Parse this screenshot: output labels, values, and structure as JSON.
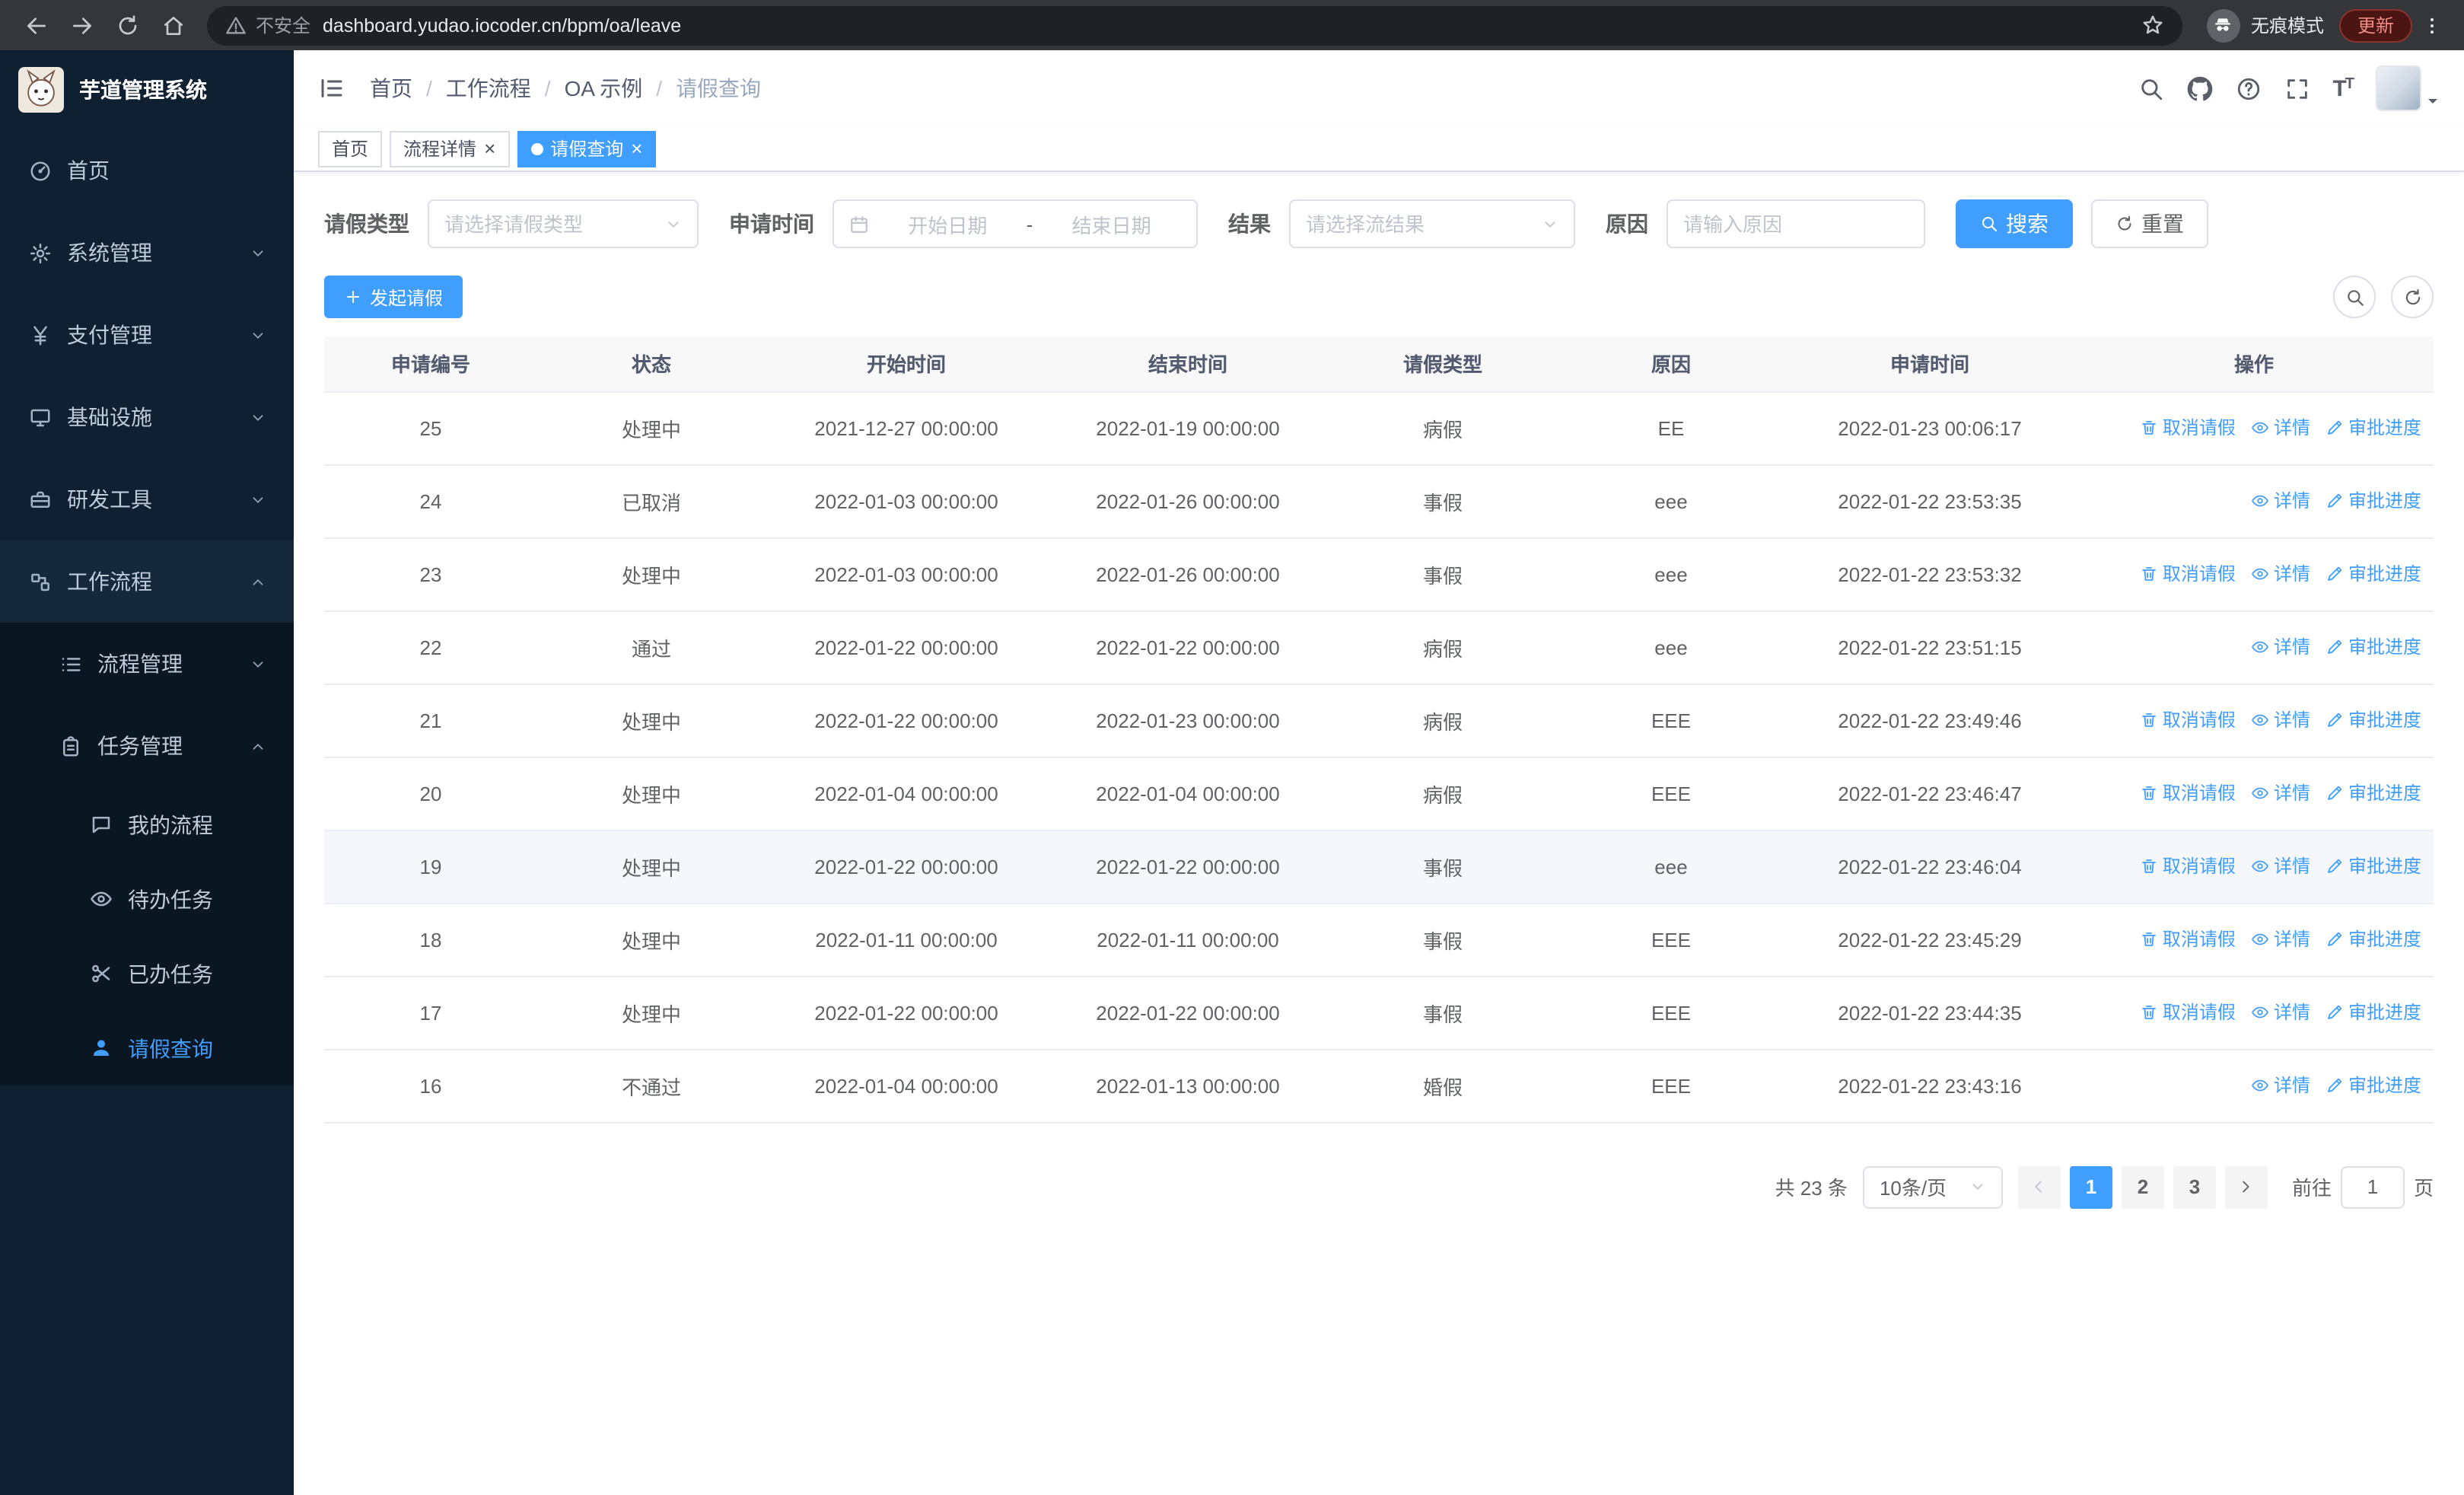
{
  "theme": {
    "primary": "#409eff",
    "sidebar_bg": "#0f2030",
    "sidebar_submenu_bg": "#0a1622",
    "tag_active_bg": "#409eff"
  },
  "browser": {
    "security_label": "不安全",
    "url": "dashboard.yudao.iocoder.cn/bpm/oa/leave",
    "incognito_label": "无痕模式",
    "update_label": "更新"
  },
  "sidebar": {
    "title": "芋道管理系统",
    "items": [
      {
        "label": "首页"
      },
      {
        "label": "系统管理"
      },
      {
        "label": "支付管理"
      },
      {
        "label": "基础设施"
      },
      {
        "label": "研发工具"
      },
      {
        "label": "工作流程"
      },
      {
        "label": "流程管理"
      },
      {
        "label": "任务管理"
      },
      {
        "label": "我的流程"
      },
      {
        "label": "待办任务"
      },
      {
        "label": "已办任务"
      },
      {
        "label": "请假查询"
      }
    ]
  },
  "breadcrumb": {
    "separator": "/",
    "items": [
      "首页",
      "工作流程",
      "OA 示例",
      "请假查询"
    ]
  },
  "tabs": [
    {
      "label": "首页"
    },
    {
      "label": "流程详情"
    },
    {
      "label": "请假查询"
    }
  ],
  "filters": {
    "leave_type_label": "请假类型",
    "leave_type_placeholder": "请选择请假类型",
    "apply_time_label": "申请时间",
    "start_date_placeholder": "开始日期",
    "range_separator": "-",
    "end_date_placeholder": "结束日期",
    "result_label": "结果",
    "result_placeholder": "请选择流结果",
    "reason_label": "原因",
    "reason_placeholder": "请输入原因",
    "search_button": "搜索",
    "reset_button": "重置"
  },
  "toolbar": {
    "create_button": "发起请假"
  },
  "table": {
    "headers": [
      "申请编号",
      "状态",
      "开始时间",
      "结束时间",
      "请假类型",
      "原因",
      "申请时间",
      "操作"
    ],
    "action_labels": {
      "cancel": "取消请假",
      "detail": "详情",
      "progress": "审批进度"
    },
    "rows": [
      {
        "id": "25",
        "status": "处理中",
        "start": "2021-12-27 00:00:00",
        "end": "2022-01-19 00:00:00",
        "type": "病假",
        "reason": "EE",
        "apply_time": "2022-01-23 00:06:17",
        "actions": [
          "cancel",
          "detail",
          "progress"
        ],
        "highlight": false
      },
      {
        "id": "24",
        "status": "已取消",
        "start": "2022-01-03 00:00:00",
        "end": "2022-01-26 00:00:00",
        "type": "事假",
        "reason": "eee",
        "apply_time": "2022-01-22 23:53:35",
        "actions": [
          "detail",
          "progress"
        ],
        "highlight": false
      },
      {
        "id": "23",
        "status": "处理中",
        "start": "2022-01-03 00:00:00",
        "end": "2022-01-26 00:00:00",
        "type": "事假",
        "reason": "eee",
        "apply_time": "2022-01-22 23:53:32",
        "actions": [
          "cancel",
          "detail",
          "progress"
        ],
        "highlight": false
      },
      {
        "id": "22",
        "status": "通过",
        "start": "2022-01-22 00:00:00",
        "end": "2022-01-22 00:00:00",
        "type": "病假",
        "reason": "eee",
        "apply_time": "2022-01-22 23:51:15",
        "actions": [
          "detail",
          "progress"
        ],
        "highlight": false
      },
      {
        "id": "21",
        "status": "处理中",
        "start": "2022-01-22 00:00:00",
        "end": "2022-01-23 00:00:00",
        "type": "病假",
        "reason": "EEE",
        "apply_time": "2022-01-22 23:49:46",
        "actions": [
          "cancel",
          "detail",
          "progress"
        ],
        "highlight": false
      },
      {
        "id": "20",
        "status": "处理中",
        "start": "2022-01-04 00:00:00",
        "end": "2022-01-04 00:00:00",
        "type": "病假",
        "reason": "EEE",
        "apply_time": "2022-01-22 23:46:47",
        "actions": [
          "cancel",
          "detail",
          "progress"
        ],
        "highlight": false
      },
      {
        "id": "19",
        "status": "处理中",
        "start": "2022-01-22 00:00:00",
        "end": "2022-01-22 00:00:00",
        "type": "事假",
        "reason": "eee",
        "apply_time": "2022-01-22 23:46:04",
        "actions": [
          "cancel",
          "detail",
          "progress"
        ],
        "highlight": true
      },
      {
        "id": "18",
        "status": "处理中",
        "start": "2022-01-11 00:00:00",
        "end": "2022-01-11 00:00:00",
        "type": "事假",
        "reason": "EEE",
        "apply_time": "2022-01-22 23:45:29",
        "actions": [
          "cancel",
          "detail",
          "progress"
        ],
        "highlight": false
      },
      {
        "id": "17",
        "status": "处理中",
        "start": "2022-01-22 00:00:00",
        "end": "2022-01-22 00:00:00",
        "type": "事假",
        "reason": "EEE",
        "apply_time": "2022-01-22 23:44:35",
        "actions": [
          "cancel",
          "detail",
          "progress"
        ],
        "highlight": false
      },
      {
        "id": "16",
        "status": "不通过",
        "start": "2022-01-04 00:00:00",
        "end": "2022-01-13 00:00:00",
        "type": "婚假",
        "reason": "EEE",
        "apply_time": "2022-01-22 23:43:16",
        "actions": [
          "detail",
          "progress"
        ],
        "highlight": false
      }
    ]
  },
  "pagination": {
    "total_text": "共 23 条",
    "page_size": "10条/页",
    "pages": [
      "1",
      "2",
      "3"
    ],
    "current_page": "1",
    "goto_prefix": "前往",
    "goto_value": "1",
    "goto_suffix": "页"
  }
}
